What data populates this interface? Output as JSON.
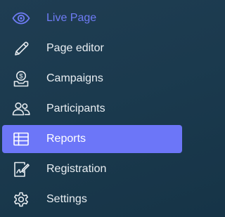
{
  "sidebar": {
    "items": [
      {
        "label": "Live Page",
        "icon": "eye-icon"
      },
      {
        "label": "Page editor",
        "icon": "pencil-icon"
      },
      {
        "label": "Campaigns",
        "icon": "donation-box-icon"
      },
      {
        "label": "Participants",
        "icon": "users-icon"
      },
      {
        "label": "Reports",
        "icon": "table-icon"
      },
      {
        "label": "Registration",
        "icon": "signature-form-icon"
      },
      {
        "label": "Settings",
        "icon": "gear-icon"
      }
    ],
    "active_item": "Reports",
    "colors": {
      "accent": "#6c76f8",
      "live_text": "#6f7cf6",
      "text": "#e9eef2",
      "background": "#1d3b50"
    }
  }
}
